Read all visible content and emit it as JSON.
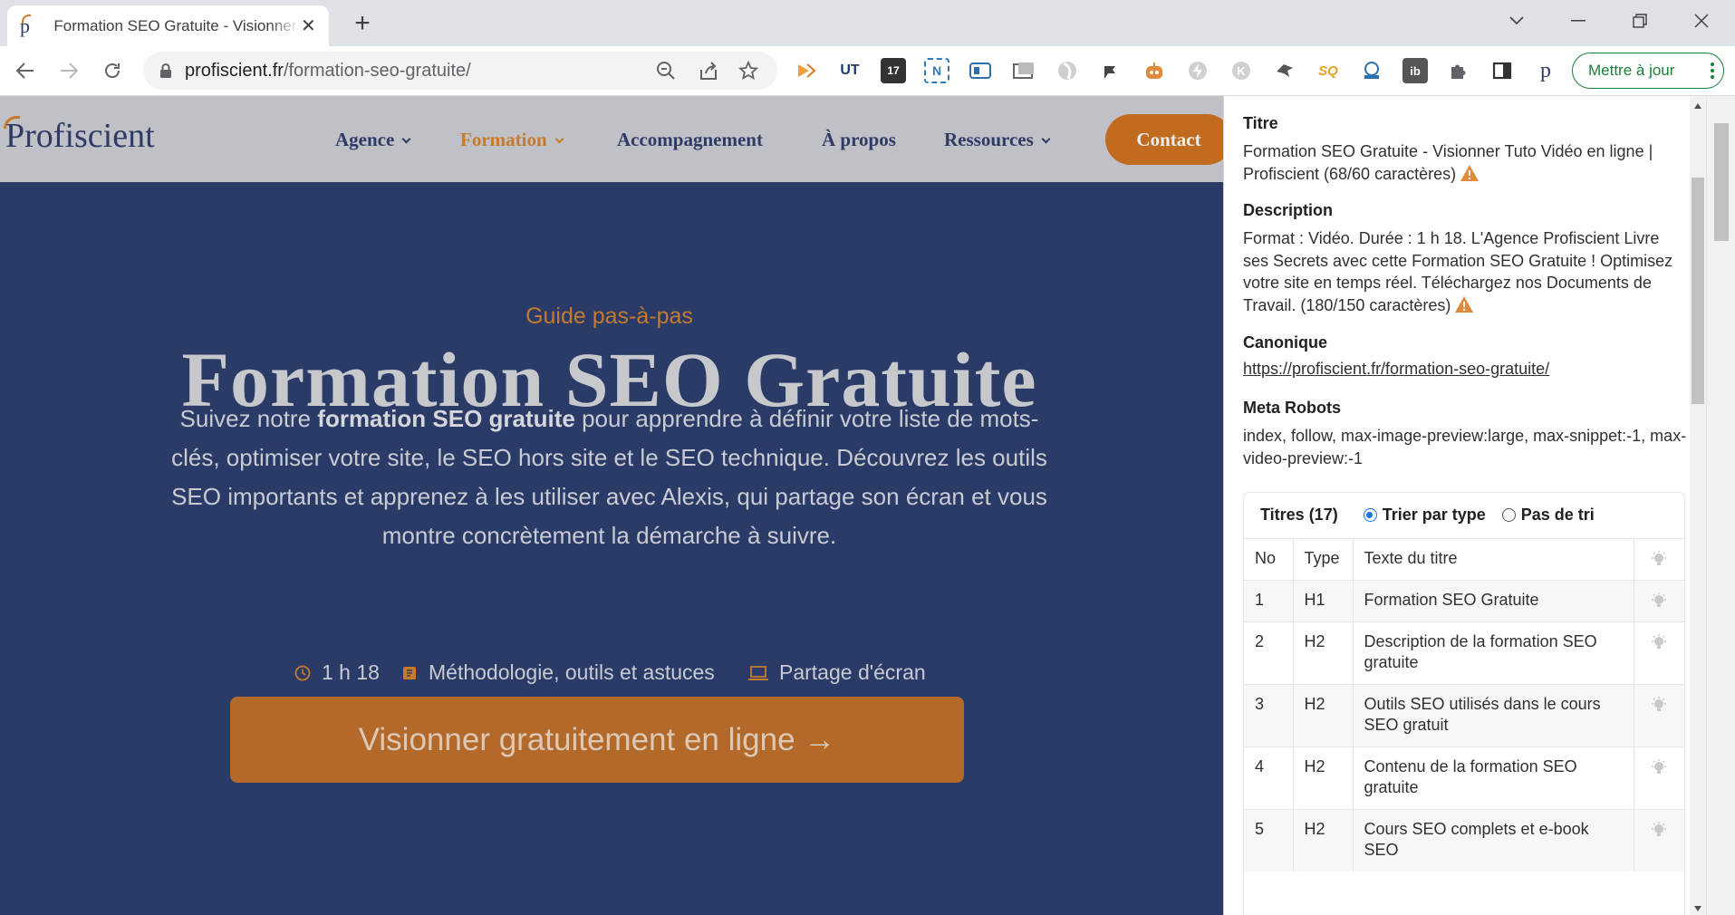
{
  "browser": {
    "tab_title": "Formation SEO Gratuite - Visionner Tuto Vidéo en ligne | Profiscient",
    "url_domain": "profiscient.fr",
    "url_path": "/formation-seo-gratuite/",
    "update_button": "Mettre à jour"
  },
  "site": {
    "logo": "Profiscient",
    "nav": [
      {
        "label": "Agence"
      },
      {
        "label": "Formation"
      },
      {
        "label": "Accompagnement"
      },
      {
        "label": "À propos"
      },
      {
        "label": "Ressources"
      }
    ],
    "contact": "Contact",
    "accent_color": "#c77a2c",
    "hero_color": "#2b3b67"
  },
  "hero": {
    "eyebrow": "Guide pas-à-pas",
    "title": "Formation SEO Gratuite",
    "desc_before": "Suivez notre ",
    "desc_bold": "formation SEO gratuite",
    "desc_after": " pour apprendre à définir votre liste de mots-clés, optimiser votre site, le SEO hors site et le SEO technique. Découvrez les outils SEO importants et apprenez à les utiliser avec Alexis, qui partage son écran et vous montre concrètement la démarche à suivre.",
    "duration": "1 h 18",
    "content": "Méthodologie, outils et astuces",
    "format": "Partage d'écran",
    "cta": "Visionner gratuitement en ligne →"
  },
  "panel": {
    "title_label": "Titre",
    "title_value": "Formation SEO Gratuite - Visionner Tuto Vidéo en ligne | Profiscient (68/60 caractères)",
    "desc_label": "Description",
    "desc_value": "Format : Vidéo. Durée : 1 h 18. L'Agence Profiscient Livre ses Secrets avec cette Formation SEO Gratuite ! Optimisez votre site en temps réel. Téléchargez nos Documents de Travail. (180/150 caractères)",
    "canonical_label": "Canonique",
    "canonical_value": "https://profiscient.fr/formation-seo-gratuite/",
    "robots_label": "Meta Robots",
    "robots_value": "index, follow, max-image-preview:large, max-snippet:-1, max-video-preview:-1",
    "headings_label": "Titres (17)",
    "sort_by_type": "Trier par type",
    "no_sort": "Pas de tri",
    "columns": [
      "No",
      "Type",
      "Texte du titre"
    ],
    "rows": [
      {
        "no": "1",
        "type": "H1",
        "text": "Formation SEO Gratuite"
      },
      {
        "no": "2",
        "type": "H2",
        "text": "Description de la formation SEO gratuite"
      },
      {
        "no": "3",
        "type": "H2",
        "text": "Outils SEO utilisés dans le cours SEO gratuit"
      },
      {
        "no": "4",
        "type": "H2",
        "text": "Contenu de la formation SEO gratuite"
      },
      {
        "no": "5",
        "type": "H2",
        "text": "Cours SEO complets et e-book SEO"
      }
    ],
    "warning_color": "#e08a3c"
  }
}
